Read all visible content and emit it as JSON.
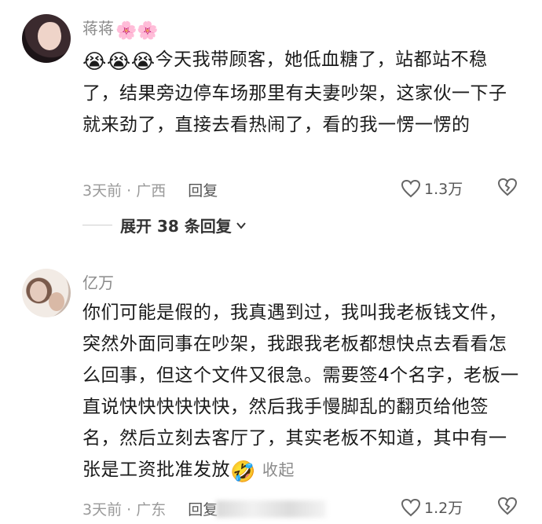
{
  "comments": [
    {
      "username": "蒋蒋",
      "username_decor": "🌸🌸",
      "emoji_prefix": "😭😭😭",
      "text": "今天我带顾客，她低血糖了，站都站不稳了，结果旁边停车场那里有夫妻吵架，这家伙一下子就来劲了，直接去看热闹了，看的我一愣一愣的",
      "meta": "3天前 · 广西",
      "reply_label": "回复",
      "likes": "1.3万"
    },
    {
      "username": "亿万",
      "text": "你们可能是假的，我真遇到过，我叫我老板钱文件，突然外面同事在吵架，我跟我老板都想快点去看看怎么回事，但这个文件又很急。需要签4个名字，老板一直说快快快快快快，然后我手慢脚乱的翻页给他签名，然后立刻去客厅了，其实老板不知道，其中有一张是工资批准发放",
      "emoji_suffix": "🤣",
      "collapse_label": "收起",
      "meta": "3天前 · 广东",
      "reply_label": "回复",
      "likes": "1.2万"
    }
  ],
  "expand_replies_label": "展开 38 条回复",
  "icons": {
    "like": "heart-outline-icon",
    "dislike": "broken-heart-icon",
    "expand": "chevron-down-icon"
  }
}
